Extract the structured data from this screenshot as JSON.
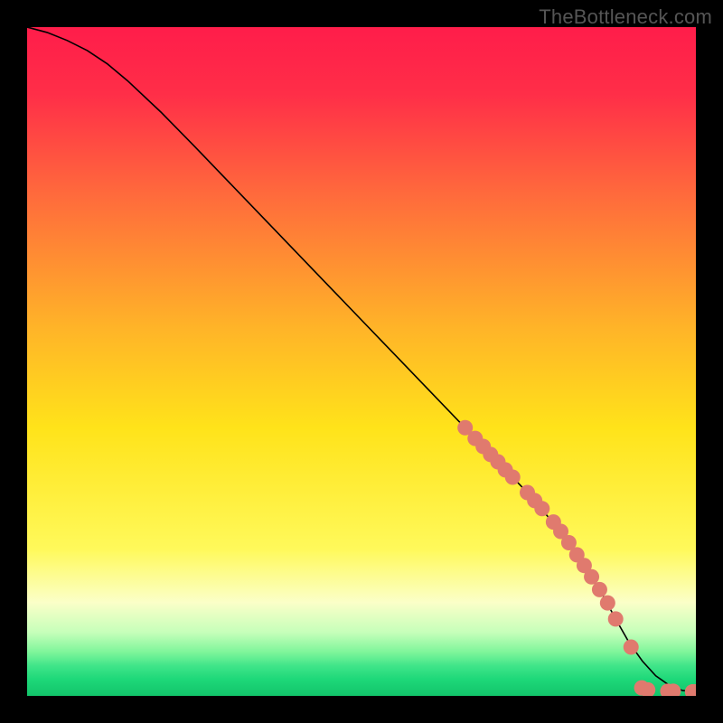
{
  "watermark": "TheBottleneck.com",
  "colors": {
    "gradient_stops": [
      {
        "offset": 0.0,
        "color": "#ff1d4a"
      },
      {
        "offset": 0.1,
        "color": "#ff2e48"
      },
      {
        "offset": 0.25,
        "color": "#ff6a3c"
      },
      {
        "offset": 0.45,
        "color": "#ffb428"
      },
      {
        "offset": 0.6,
        "color": "#ffe31a"
      },
      {
        "offset": 0.78,
        "color": "#fff95a"
      },
      {
        "offset": 0.86,
        "color": "#fbffc8"
      },
      {
        "offset": 0.905,
        "color": "#c6ffba"
      },
      {
        "offset": 0.935,
        "color": "#7df59a"
      },
      {
        "offset": 0.955,
        "color": "#40e589"
      },
      {
        "offset": 0.975,
        "color": "#1ed879"
      },
      {
        "offset": 1.0,
        "color": "#12c46a"
      }
    ],
    "curve": "#000000",
    "marker_fill": "#e07a6e",
    "marker_stroke": "#d86e61"
  },
  "chart_data": {
    "type": "line",
    "title": "",
    "xlabel": "",
    "ylabel": "",
    "xlim": [
      0,
      100
    ],
    "ylim": [
      0,
      100
    ],
    "grid": false,
    "series": [
      {
        "name": "curve",
        "x": [
          0,
          3,
          6,
          9,
          12,
          15,
          20,
          25,
          30,
          35,
          40,
          45,
          50,
          55,
          60,
          65,
          70,
          75,
          80,
          83,
          86,
          88,
          90,
          92,
          94,
          96,
          98,
          100
        ],
        "y": [
          100,
          99.2,
          98.0,
          96.5,
          94.5,
          92.0,
          87.3,
          82.2,
          77.0,
          71.8,
          66.6,
          61.4,
          56.2,
          51.0,
          45.8,
          40.6,
          35.4,
          30.2,
          24.3,
          20.0,
          15.2,
          11.5,
          8.0,
          5.2,
          3.0,
          1.6,
          0.8,
          0.6
        ]
      }
    ],
    "markers": [
      {
        "x": 65.5,
        "y": 40.1
      },
      {
        "x": 67.0,
        "y": 38.5
      },
      {
        "x": 68.2,
        "y": 37.3
      },
      {
        "x": 69.3,
        "y": 36.1
      },
      {
        "x": 70.4,
        "y": 35.0
      },
      {
        "x": 71.5,
        "y": 33.8
      },
      {
        "x": 72.6,
        "y": 32.7
      },
      {
        "x": 74.8,
        "y": 30.4
      },
      {
        "x": 75.9,
        "y": 29.2
      },
      {
        "x": 77.0,
        "y": 28.0
      },
      {
        "x": 78.7,
        "y": 26.0
      },
      {
        "x": 79.8,
        "y": 24.6
      },
      {
        "x": 81.0,
        "y": 22.9
      },
      {
        "x": 82.2,
        "y": 21.1
      },
      {
        "x": 83.3,
        "y": 19.5
      },
      {
        "x": 84.4,
        "y": 17.8
      },
      {
        "x": 85.6,
        "y": 15.9
      },
      {
        "x": 86.8,
        "y": 13.9
      },
      {
        "x": 88.0,
        "y": 11.5
      },
      {
        "x": 90.3,
        "y": 7.3
      },
      {
        "x": 91.9,
        "y": 1.2
      },
      {
        "x": 92.8,
        "y": 0.9
      },
      {
        "x": 95.8,
        "y": 0.7
      },
      {
        "x": 96.6,
        "y": 0.7
      },
      {
        "x": 99.5,
        "y": 0.6
      },
      {
        "x": 100.0,
        "y": 0.6
      }
    ]
  }
}
